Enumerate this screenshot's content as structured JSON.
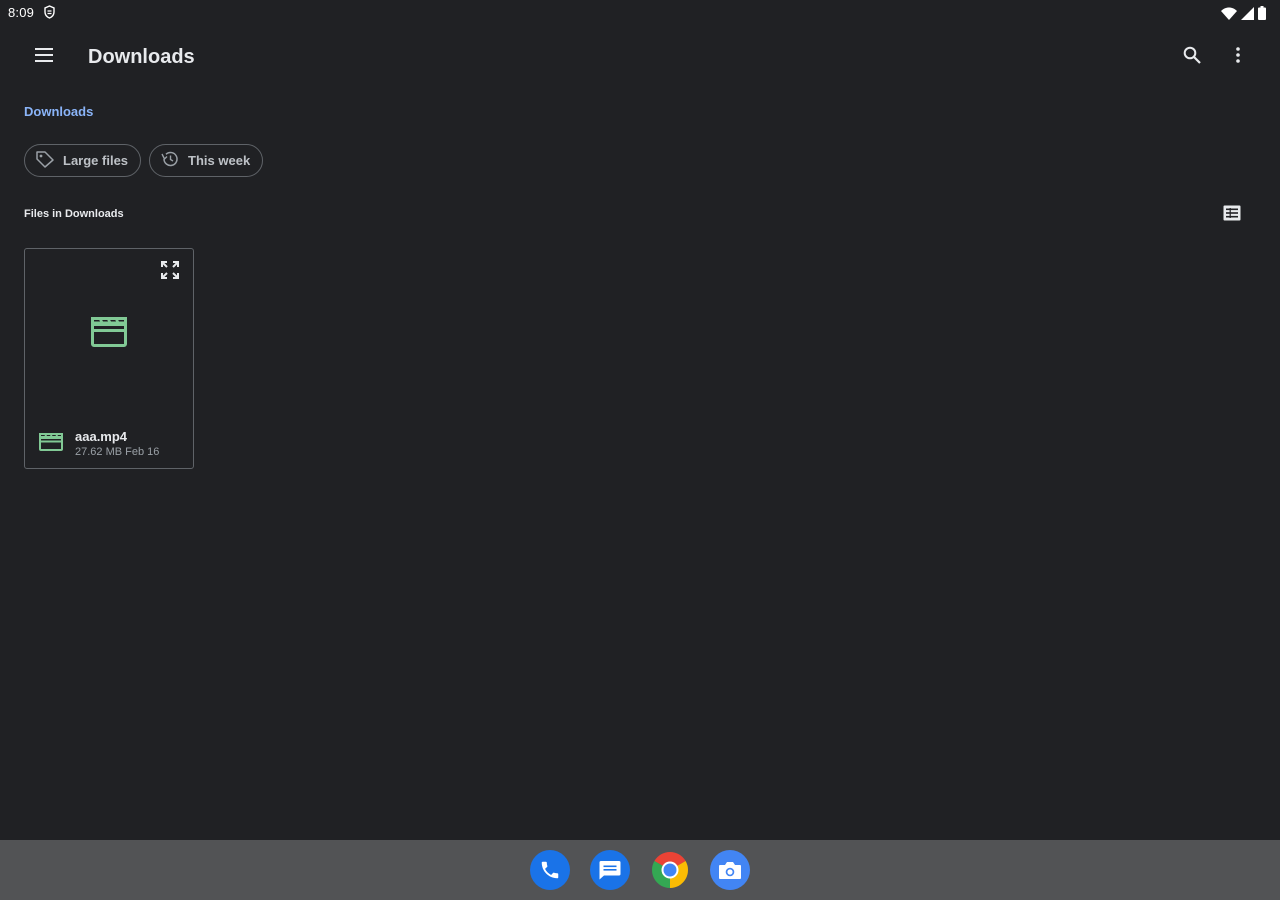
{
  "status_bar": {
    "time": "8:09",
    "icons": [
      "shield-icon",
      "wifi-icon",
      "cellular-signal-icon",
      "battery-icon"
    ]
  },
  "app_bar": {
    "title": "Downloads",
    "icons": [
      "menu-icon",
      "search-icon",
      "more-vert-icon"
    ]
  },
  "breadcrumb": {
    "label": "Downloads"
  },
  "chips": [
    {
      "label": "Large files",
      "icon": "label-tag-icon"
    },
    {
      "label": "This week",
      "icon": "history-clock-icon"
    }
  ],
  "section": {
    "title": "Files in Downloads",
    "view_toggle_icon": "list-view-icon"
  },
  "files": [
    {
      "name": "aaa.mp4",
      "size": "27.62 MB",
      "date": "Feb 16",
      "meta": "27.62 MB Feb 16",
      "icon": "movie-clapperboard-icon"
    }
  ],
  "dock": {
    "apps": [
      "phone-app-icon",
      "messages-app-icon",
      "chrome-app-icon",
      "camera-app-icon"
    ]
  },
  "colors": {
    "background": "#202124",
    "accent": "#8ab4f8",
    "video_icon": "#81c995",
    "dock": "#525355",
    "outline": "#5f6368"
  }
}
